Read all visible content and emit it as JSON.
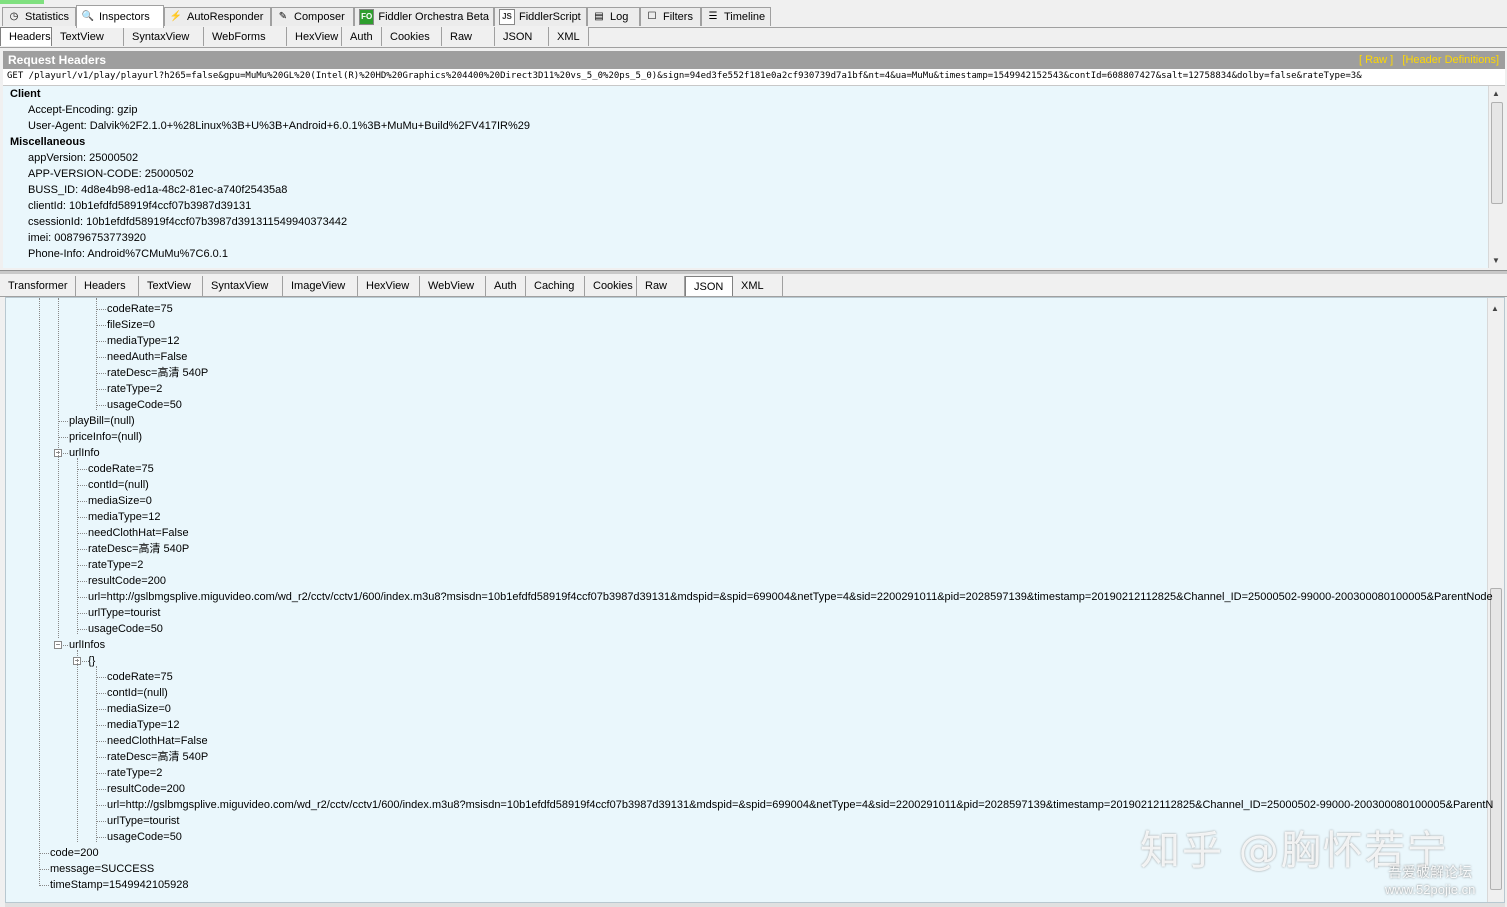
{
  "main_tabs": [
    {
      "label": "Statistics",
      "icon": "stopwatch-icon"
    },
    {
      "label": "Inspectors",
      "icon": "magnifier-icon"
    },
    {
      "label": "AutoResponder",
      "icon": "lightning-icon"
    },
    {
      "label": "Composer",
      "icon": "pencil-icon"
    },
    {
      "label": "Fiddler Orchestra Beta",
      "icon": "fo-icon",
      "icon_text": "FO"
    },
    {
      "label": "FiddlerScript",
      "icon": "script-icon",
      "icon_text": "JS"
    },
    {
      "label": "Log",
      "icon": "log-icon"
    },
    {
      "label": "Filters",
      "icon": "checkbox-icon"
    },
    {
      "label": "Timeline",
      "icon": "timeline-icon"
    }
  ],
  "request_tabs": [
    "Headers",
    "TextView",
    "SyntaxView",
    "WebForms",
    "HexView",
    "Auth",
    "Cookies",
    "Raw",
    "JSON",
    "XML"
  ],
  "request": {
    "title": "Request Headers",
    "raw_link": "[ Raw ]",
    "defs_link": "[Header Definitions]",
    "request_line": "GET /playurl/v1/play/playurl?h265=false&gpu=MuMu%20GL%20(Intel(R)%20HD%20Graphics%204400%20Direct3D11%20vs_5_0%20ps_5_0)&sign=94ed3fe552f181e0a2cf930739d7a1bf&nt=4&ua=MuMu&timestamp=1549942152543&contId=608807427&salt=12758834&dolby=false&rateType=3&",
    "groups": [
      {
        "name": "Client",
        "items": [
          "Accept-Encoding: gzip",
          "User-Agent: Dalvik%2F2.1.0+%28Linux%3B+U%3B+Android+6.0.1%3B+MuMu+Build%2FV417IR%29"
        ]
      },
      {
        "name": "Miscellaneous",
        "items": [
          "appVersion: 25000502",
          "APP-VERSION-CODE: 25000502",
          "BUSS_ID: 4d8e4b98-ed1a-48c2-81ec-a740f25435a8",
          "clientId: 10b1efdfd58919f4ccf07b3987d39131",
          "csessionId: 10b1efdfd58919f4ccf07b3987d391311549940373442",
          "imei: 008796753773920",
          "Phone-Info: Android%7CMuMu%7C6.0.1"
        ]
      }
    ]
  },
  "response_tabs": [
    "Transformer",
    "Headers",
    "TextView",
    "SyntaxView",
    "ImageView",
    "HexView",
    "WebView",
    "Auth",
    "Caching",
    "Cookies",
    "Raw",
    "JSON",
    "XML"
  ],
  "tree": [
    {
      "t": "codeRate=75",
      "lvl": 5
    },
    {
      "t": "fileSize=0",
      "lvl": 5
    },
    {
      "t": "mediaType=12",
      "lvl": 5
    },
    {
      "t": "needAuth=False",
      "lvl": 5
    },
    {
      "t": "rateDesc=高清 540P",
      "lvl": 5
    },
    {
      "t": "rateType=2",
      "lvl": 5
    },
    {
      "t": "usageCode=50",
      "lvl": 5
    },
    {
      "t": "playBill=(null)",
      "lvl": 3
    },
    {
      "t": "priceInfo=(null)",
      "lvl": 3
    },
    {
      "t": "urlInfo",
      "lvl": 3,
      "exp": true
    },
    {
      "t": "codeRate=75",
      "lvl": 4
    },
    {
      "t": "contId=(null)",
      "lvl": 4
    },
    {
      "t": "mediaSize=0",
      "lvl": 4
    },
    {
      "t": "mediaType=12",
      "lvl": 4
    },
    {
      "t": "needClothHat=False",
      "lvl": 4
    },
    {
      "t": "rateDesc=高清 540P",
      "lvl": 4
    },
    {
      "t": "rateType=2",
      "lvl": 4
    },
    {
      "t": "resultCode=200",
      "lvl": 4
    },
    {
      "t": "url=http://gslbmgsplive.miguvideo.com/wd_r2/cctv/cctv1/600/index.m3u8?msisdn=10b1efdfd58919f4ccf07b3987d39131&mdspid=&spid=699004&netType=4&sid=2200291011&pid=2028597139&timestamp=20190212112825&Channel_ID=25000502-99000-200300080100005&ParentNode",
      "lvl": 4
    },
    {
      "t": "urlType=tourist",
      "lvl": 4
    },
    {
      "t": "usageCode=50",
      "lvl": 4
    },
    {
      "t": "urlInfos",
      "lvl": 3,
      "exp": true
    },
    {
      "t": "{}",
      "lvl": 4,
      "exp": true
    },
    {
      "t": "codeRate=75",
      "lvl": 5
    },
    {
      "t": "contId=(null)",
      "lvl": 5
    },
    {
      "t": "mediaSize=0",
      "lvl": 5
    },
    {
      "t": "mediaType=12",
      "lvl": 5
    },
    {
      "t": "needClothHat=False",
      "lvl": 5
    },
    {
      "t": "rateDesc=高清 540P",
      "lvl": 5
    },
    {
      "t": "rateType=2",
      "lvl": 5
    },
    {
      "t": "resultCode=200",
      "lvl": 5
    },
    {
      "t": "url=http://gslbmgsplive.miguvideo.com/wd_r2/cctv/cctv1/600/index.m3u8?msisdn=10b1efdfd58919f4ccf07b3987d39131&mdspid=&spid=699004&netType=4&sid=2200291011&pid=2028597139&timestamp=20190212112825&Channel_ID=25000502-99000-200300080100005&ParentN",
      "lvl": 5
    },
    {
      "t": "urlType=tourist",
      "lvl": 5
    },
    {
      "t": "usageCode=50",
      "lvl": 5
    },
    {
      "t": "code=200",
      "lvl": 2
    },
    {
      "t": "message=SUCCESS",
      "lvl": 2
    },
    {
      "t": "timeStamp=1549942105928",
      "lvl": 2
    }
  ],
  "watermark": {
    "main": "知乎 @胸怀若宁",
    "forum": "吾爱破解论坛",
    "site": "www.52pojie.cn"
  }
}
